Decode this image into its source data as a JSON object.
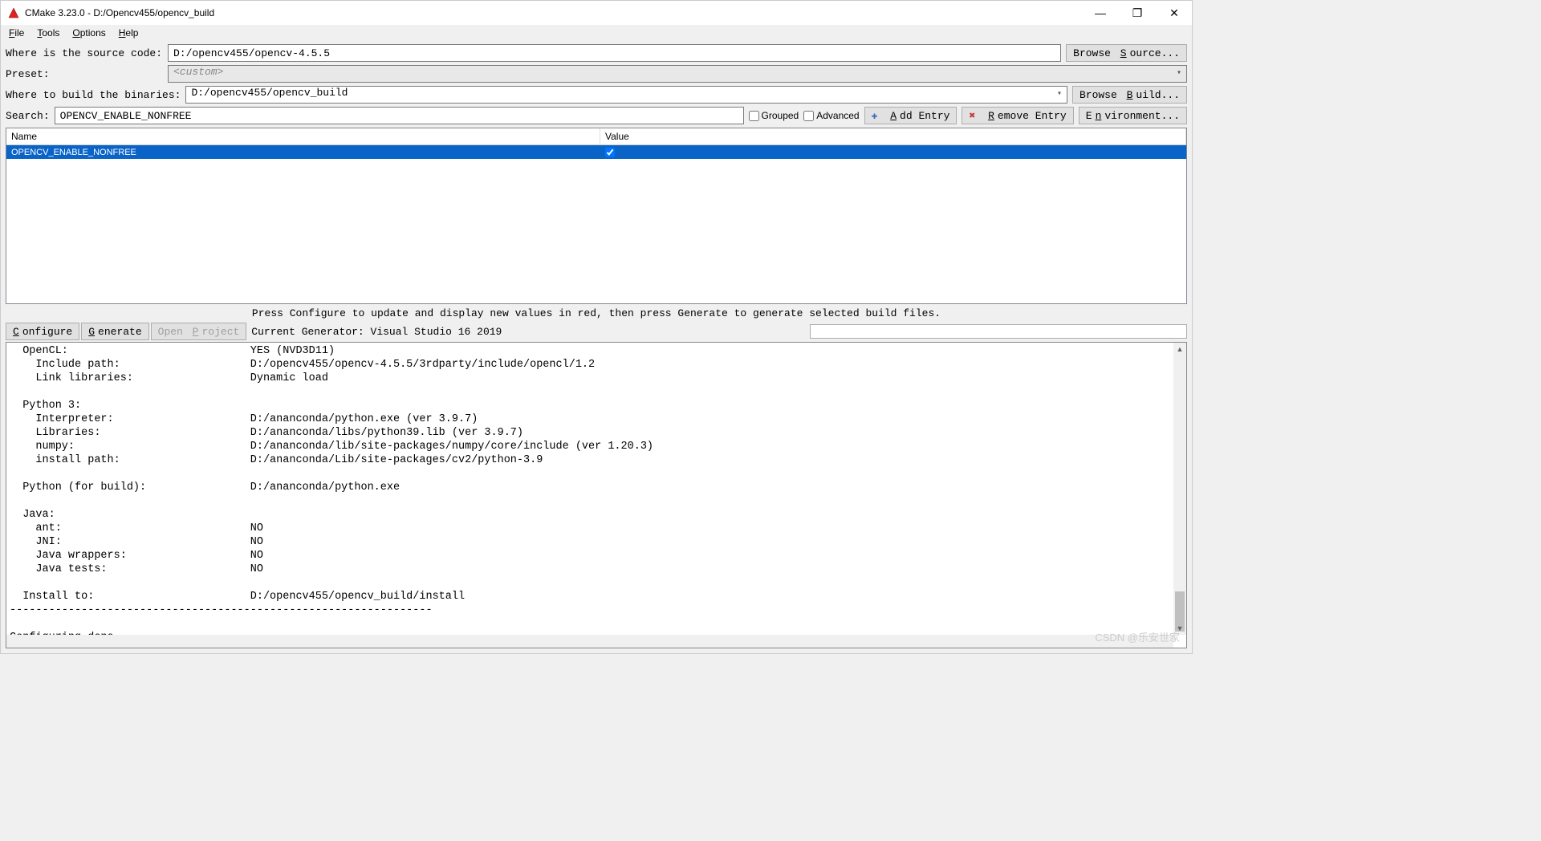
{
  "titlebar": {
    "app_title": "CMake 3.23.0 - D:/Opencv455/opencv_build"
  },
  "menu": {
    "file": "File",
    "tools": "Tools",
    "options": "Options",
    "help": "Help"
  },
  "form": {
    "source_label": "Where is the source code:",
    "source_value": "D:/opencv455/opencv-4.5.5",
    "browse_source": "Browse Source...",
    "preset_label": "Preset:",
    "preset_value": "<custom>",
    "build_label": "Where to build the binaries:",
    "build_value": "D:/opencv455/opencv_build",
    "browse_build": "Browse Build..."
  },
  "search": {
    "label": "Search:",
    "value": "OPENCV_ENABLE_NONFREE",
    "grouped": "Grouped",
    "advanced": "Advanced",
    "add_entry": "Add Entry",
    "remove_entry": "Remove Entry",
    "environment": "Environment..."
  },
  "table": {
    "header_name": "Name",
    "header_value": "Value",
    "rows": [
      {
        "name": "OPENCV_ENABLE_NONFREE",
        "checked": true
      }
    ]
  },
  "hint": "Press Configure to update and display new values in red, then press Generate to generate selected build files.",
  "actions": {
    "configure": "Configure",
    "generate": "Generate",
    "open_project": "Open Project",
    "generator_label": "Current Generator: Visual Studio 16 2019"
  },
  "output": "  OpenCL:                            YES (NVD3D11)\n    Include path:                    D:/opencv455/opencv-4.5.5/3rdparty/include/opencl/1.2\n    Link libraries:                  Dynamic load\n\n  Python 3:\n    Interpreter:                     D:/ananconda/python.exe (ver 3.9.7)\n    Libraries:                       D:/ananconda/libs/python39.lib (ver 3.9.7)\n    numpy:                           D:/ananconda/lib/site-packages/numpy/core/include (ver 1.20.3)\n    install path:                    D:/ananconda/Lib/site-packages/cv2/python-3.9\n\n  Python (for build):                D:/ananconda/python.exe\n\n  Java:\n    ant:                             NO\n    JNI:                             NO\n    Java wrappers:                   NO\n    Java tests:                      NO\n\n  Install to:                        D:/opencv455/opencv_build/install\n-----------------------------------------------------------------\n\nConfiguring done",
  "watermark": "CSDN @乐安世家"
}
